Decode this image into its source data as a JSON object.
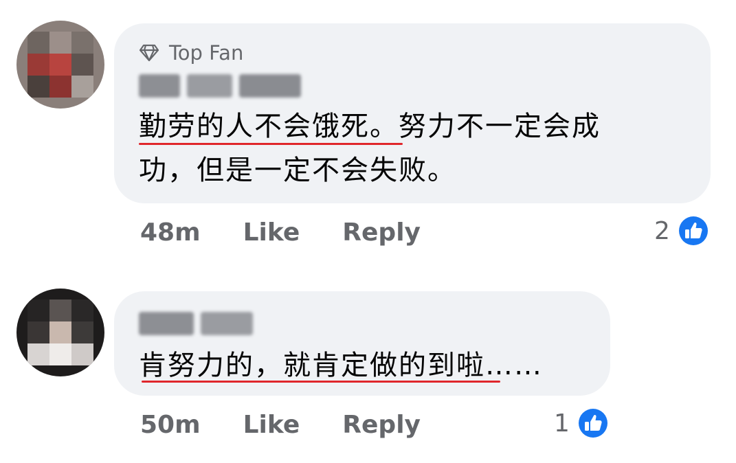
{
  "comments": [
    {
      "badge": "Top Fan",
      "text_line1_a": "勤劳的人不会饿死",
      "text_line1_b": "。努力不一定会成",
      "text_line2": "功，但是一定不会失败。",
      "time": "48m",
      "like_label": "Like",
      "reply_label": "Reply",
      "reaction_count": "2"
    },
    {
      "text_line1_a": "肯努力的，就肯定做的到",
      "text_line1_b": "啦……",
      "time": "50m",
      "like_label": "Like",
      "reply_label": "Reply",
      "reaction_count": "1"
    }
  ],
  "colors": {
    "bubble": "#f0f2f5",
    "meta_text": "#65676b",
    "like_blue": "#1877f2",
    "underline_red": "#e0262b"
  },
  "icons": {
    "badge": "diamond-icon",
    "reaction": "thumbs-up-icon"
  }
}
